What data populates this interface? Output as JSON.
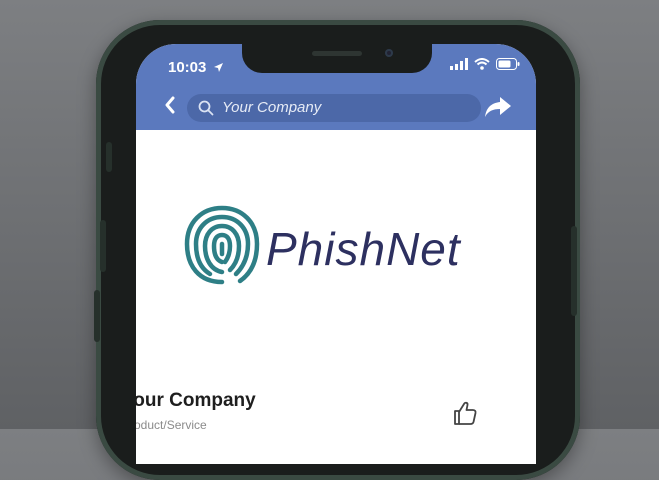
{
  "status_bar": {
    "time": "10:03",
    "location_icon": "location-arrow-icon",
    "signal_icon": "cellular-signal-icon",
    "wifi_icon": "wifi-icon",
    "battery_icon": "battery-icon"
  },
  "header": {
    "back_icon": "chevron-left-icon",
    "search_icon": "search-icon",
    "search_text": "Your Company",
    "share_icon": "share-arrow-icon",
    "color": "#5b79be"
  },
  "logo": {
    "brand_text": "PhishNet",
    "icon": "fingerprint-icon",
    "text_color": "#2d3060",
    "icon_color": "#2e7f86"
  },
  "page": {
    "name": "Your Company",
    "category": "Product/Service",
    "like_icon": "thumbs-up-icon"
  }
}
